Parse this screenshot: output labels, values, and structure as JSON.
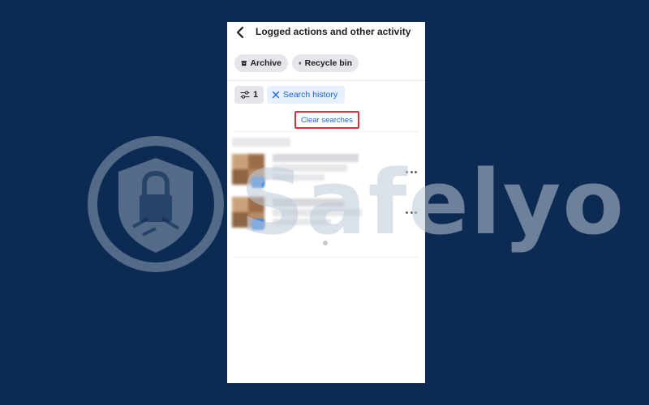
{
  "header": {
    "title": "Logged actions and other activity"
  },
  "buttons": {
    "archive": "Archive",
    "recycle_bin": "Recycle bin"
  },
  "filters": {
    "count": "1",
    "search_history": "Search history"
  },
  "actions": {
    "clear_searches": "Clear searches"
  },
  "watermark": {
    "text": "Safelyo"
  },
  "colors": {
    "background": "#0c2a52",
    "accent": "#1b62d6",
    "highlight": "#d9323a"
  },
  "icons": [
    "back-arrow-icon",
    "archive-icon",
    "trash-icon",
    "filter-sliders-icon",
    "close-icon",
    "more-horizontal-icon",
    "shield-lock-icon"
  ]
}
